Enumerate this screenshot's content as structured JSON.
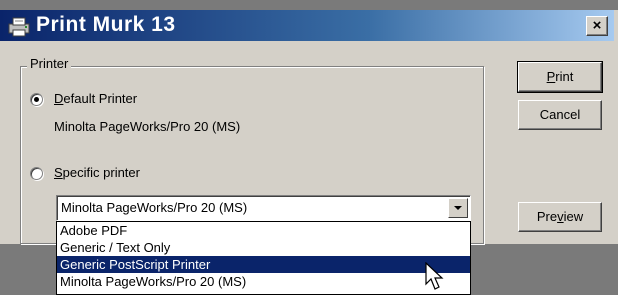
{
  "window": {
    "title": "Print Murk 13",
    "close_label": "×"
  },
  "printer_group": {
    "label": "Printer"
  },
  "default_radio": {
    "mnemonic": "D",
    "rest": "efault Printer",
    "checked": true,
    "printer_name": "Minolta PageWorks/Pro 20 (MS)"
  },
  "specific_radio": {
    "mnemonic": "S",
    "rest": "pecific printer",
    "checked": false
  },
  "printer_combo": {
    "value": "Minolta PageWorks/Pro 20 (MS)",
    "options": [
      {
        "label": "Adobe PDF",
        "selected": false
      },
      {
        "label": "Generic / Text Only",
        "selected": false
      },
      {
        "label": "Generic PostScript Printer",
        "selected": true
      },
      {
        "label": "Minolta PageWorks/Pro 20 (MS)",
        "selected": false
      }
    ]
  },
  "buttons": {
    "print": {
      "mnemonic": "P",
      "rest": "rint"
    },
    "cancel": {
      "label": "Cancel"
    },
    "preview": {
      "pre": "Pre",
      "mnemonic": "v",
      "post": "iew"
    }
  },
  "colors": {
    "title_gradient_start": "#0a246a",
    "title_gradient_end": "#a6caf0",
    "dialog_face": "#d4d0c8",
    "selection": "#0a246a",
    "background": "#7a7a7a"
  },
  "icons": {
    "title": "printer-icon",
    "close": "close-icon",
    "combo": "chevron-down-icon",
    "pointer": "mouse-pointer-icon"
  }
}
